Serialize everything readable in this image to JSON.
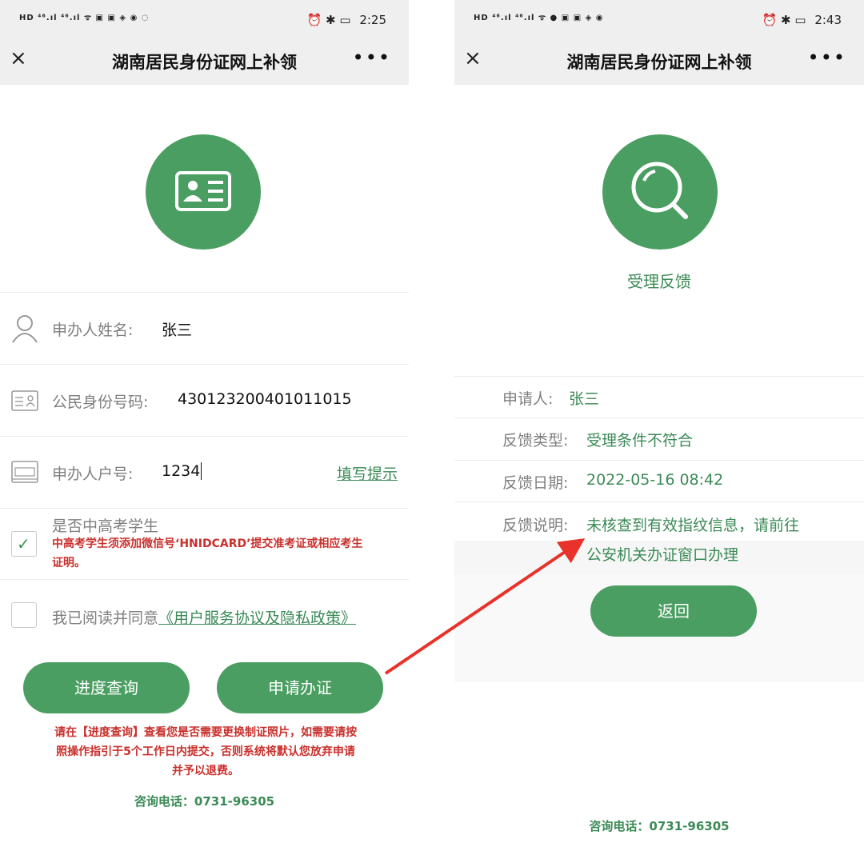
{
  "left": {
    "status": {
      "left_icons": "HD ⁴⁶.ıl ⁴⁶.ıl ᯤ ▣ ▣ ◈ ◉ ◌",
      "right_icons": "⏰ ✱ ▭",
      "time": "2:25"
    },
    "title": "湖南居民身份证网上补领",
    "close_icon": "×",
    "more_icon": "•••",
    "form": {
      "name_label": "申办人姓名:",
      "name_value": "张三",
      "id_label": "公民身份号码:",
      "id_value": "430123200401011015",
      "hukou_label": "申办人户号:",
      "hukou_value": "1234",
      "hint_link": "填写提示"
    },
    "student": {
      "label": "是否中高考学生",
      "note_line1": "中高考学生须添加微信号‘HNIDCARD’提交准考证或相应考生",
      "note_line2": "证明。",
      "checked": true
    },
    "agreement": {
      "prefix": "我已阅读并同意",
      "link": "《用户服务协议及隐私政策》",
      "checked": false
    },
    "buttons": {
      "progress": "进度查询",
      "apply": "申请办证"
    },
    "notice": {
      "line1": "请在【进度查询】查看您是否需要更换制证照片，如需要请按",
      "line2": "照操作指引于5个工作日内提交，否则系统将默认您放弃申请",
      "line3": "并予以退费。"
    },
    "phone": "咨询电话：0731-96305"
  },
  "right": {
    "status": {
      "left_icons": "HD ⁴⁶.ıl ⁴⁶.ıl ᯤ ● ▣ ▣ ◈ ◉",
      "right_icons": "⏰ ✱ ▭",
      "time": "2:43"
    },
    "title": "湖南居民身份证网上补领",
    "close_icon": "×",
    "more_icon": "•••",
    "heading": "受理反馈",
    "feedback": {
      "applicant_label": "申请人:",
      "applicant_value": "张三",
      "type_label": "反馈类型:",
      "type_value": "受理条件不符合",
      "date_label": "反馈日期:",
      "date_value": "2022-05-16 08:42",
      "desc_label": "反馈说明:",
      "desc_line1": "未核查到有效指纹信息，请前往",
      "desc_line2": "公安机关办证窗口办理"
    },
    "back_button": "返回",
    "phone": "咨询电话：0731-96305"
  },
  "colors": {
    "accent": "#4b9e62",
    "warning": "#c9302c",
    "arrow": "#e8322a"
  }
}
